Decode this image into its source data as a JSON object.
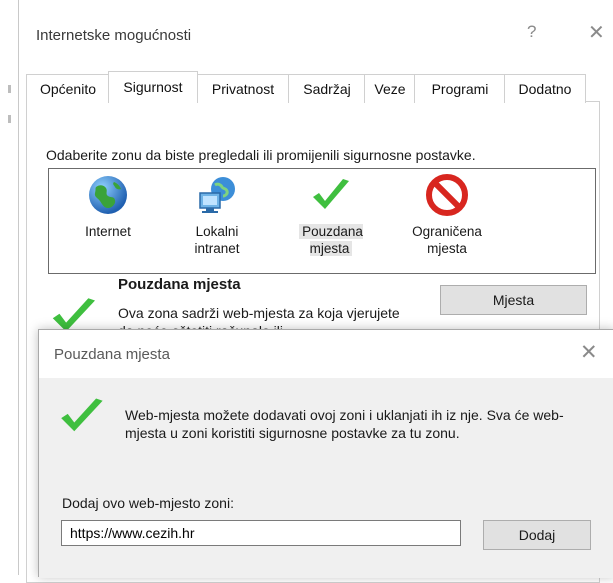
{
  "main_dialog": {
    "title": "Internetske mogućnosti",
    "help_icon": "?",
    "close_icon": "✕",
    "tabs": [
      {
        "label": "Općenito",
        "active": false
      },
      {
        "label": "Sigurnost",
        "active": true
      },
      {
        "label": "Privatnost",
        "active": false
      },
      {
        "label": "Sadržaj",
        "active": false
      },
      {
        "label": "Veze",
        "active": false
      },
      {
        "label": "Programi",
        "active": false
      },
      {
        "label": "Dodatno",
        "active": false
      }
    ],
    "zone_instruction": "Odaberite zonu da biste pregledali ili promijenili sigurnosne postavke.",
    "zones": [
      {
        "label": "Internet",
        "icon": "globe-icon"
      },
      {
        "label": "Lokalni intranet",
        "icon": "intranet-icon"
      },
      {
        "label": "Pouzdana mjesta",
        "icon": "checkmark-icon",
        "selected": true
      },
      {
        "label": "Ograničena mjesta",
        "icon": "restricted-icon"
      }
    ],
    "selected_zone": {
      "heading": "Pouzdana mjesta",
      "description": "Ova zona sadrži web-mjesta za koja vjerujete da neće oštetiti računalo ili",
      "sites_button": "Mjesta"
    }
  },
  "overlay_dialog": {
    "title": "Pouzdana mjesta",
    "close_icon": "✕",
    "message": "Web-mjesta možete dodavati ovoj zoni i uklanjati ih iz nje. Sva će web-mjesta u zoni koristiti sigurnosne postavke za tu zonu.",
    "add_label": "Dodaj ovo web-mjesto zoni:",
    "url_value": "https://www.cezih.hr",
    "add_button": "Dodaj"
  },
  "colors": {
    "check_green": "#3fbf3f",
    "restricted_red": "#d8261f",
    "globe_blue": "#1f6fc9",
    "button_bg": "#e1e1e1",
    "dialog_body_bg": "#f0f0f0"
  }
}
